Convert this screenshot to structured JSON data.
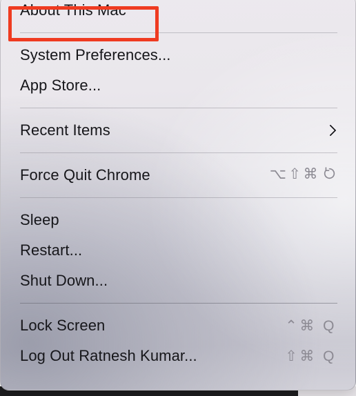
{
  "menu": {
    "name": "apple-menu",
    "groups": [
      {
        "items": [
          {
            "label": "About This Mac",
            "shortcut": "",
            "submenu": false,
            "highlighted": true
          }
        ]
      },
      {
        "items": [
          {
            "label": "System Preferences...",
            "shortcut": "",
            "submenu": false,
            "highlighted": false
          },
          {
            "label": "App Store...",
            "shortcut": "",
            "submenu": false,
            "highlighted": false
          }
        ]
      },
      {
        "items": [
          {
            "label": "Recent Items",
            "shortcut": "",
            "submenu": true,
            "highlighted": false
          }
        ]
      },
      {
        "items": [
          {
            "label": "Force Quit Chrome",
            "shortcut": "⌥⇧⌘",
            "shortcut_icon": "escape-key-icon",
            "submenu": false,
            "highlighted": false
          }
        ]
      },
      {
        "items": [
          {
            "label": "Sleep",
            "shortcut": "",
            "submenu": false,
            "highlighted": false
          },
          {
            "label": "Restart...",
            "shortcut": "",
            "submenu": false,
            "highlighted": false
          },
          {
            "label": "Shut Down...",
            "shortcut": "",
            "submenu": false,
            "highlighted": false
          }
        ]
      },
      {
        "items": [
          {
            "label": "Lock Screen",
            "shortcut": "⌃⌘ Q",
            "submenu": false,
            "highlighted": false
          },
          {
            "label": "Log Out Ratnesh Kumar...",
            "shortcut": "⇧⌘ Q",
            "submenu": false,
            "highlighted": false
          }
        ]
      }
    ]
  },
  "annotation": {
    "target_label": "About This Mac",
    "color": "#ef3b21"
  },
  "colors": {
    "menu_text": "#16161a",
    "shortcut_text": "#8c8a93",
    "separator": "#78768066",
    "annotation": "#ef3b21"
  }
}
